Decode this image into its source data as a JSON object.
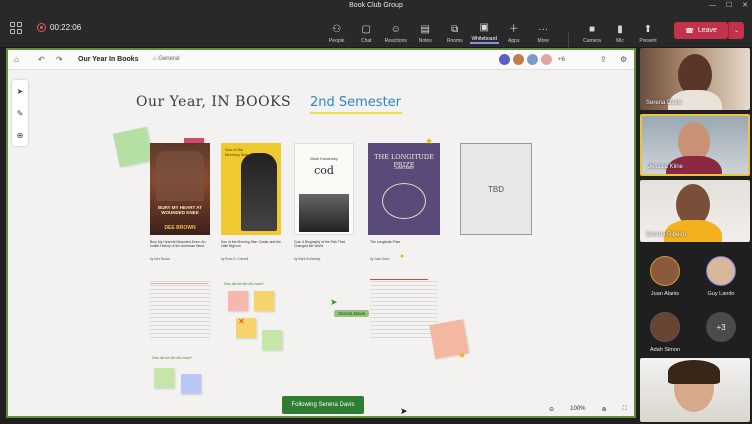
{
  "window": {
    "title": "Book Club Group"
  },
  "meeting": {
    "timer": "00:22:06",
    "toolbar": [
      {
        "label": "People",
        "icon": "people-icon"
      },
      {
        "label": "Chat",
        "icon": "chat-icon"
      },
      {
        "label": "Reactions",
        "icon": "reactions-icon"
      },
      {
        "label": "Notes",
        "icon": "notes-icon"
      },
      {
        "label": "Rooms",
        "icon": "rooms-icon"
      },
      {
        "label": "Whiteboard",
        "icon": "whiteboard-icon",
        "active": true
      },
      {
        "label": "Apps",
        "icon": "apps-icon"
      },
      {
        "label": "More",
        "icon": "more-icon"
      }
    ],
    "devices": [
      {
        "label": "Camera",
        "icon": "camera-icon"
      },
      {
        "label": "Mic",
        "icon": "mic-icon"
      },
      {
        "label": "Present",
        "icon": "present-icon"
      }
    ],
    "leave_label": "Leave"
  },
  "whiteboard": {
    "title": "Our Year In Books",
    "channel": "General",
    "extra_participants": "+6",
    "heading": "Our Year, IN BOOKS",
    "subheading": "2nd Semester",
    "tbd_label": "TBD",
    "following_label": "Following Serena Davis",
    "zoom": "100%",
    "cursor_tag": "Serena Davis",
    "books": [
      {
        "caption": "Bury My Heart at Wounded Knee: An Indian History of the American West",
        "author": "by Dee Brown",
        "cover_title": "BURY MY HEART AT WOUNDED KNEE",
        "cover_author": "DEE BROWN"
      },
      {
        "caption": "Son of the Morning Star: Custer and the Little Bighorn",
        "author": "by Evan S. Connell",
        "cover_title": "Son of the Morning Star",
        "cover_author": ""
      },
      {
        "caption": "Cod: A Biography of the Fish That Changed the World",
        "author": "by Mark Kurlansky",
        "cover_title": "cod",
        "cover_author": "Mark Kurlansky"
      },
      {
        "caption": "The Longitude Prize",
        "author": "by Joan Dash",
        "cover_title": "THE LONGITUDE PRIZE",
        "cover_author": "Joan Dash"
      }
    ],
    "green_prompts": [
      "How did we like this book?",
      "How did we like this book?"
    ]
  },
  "participants": [
    {
      "name": "Serena Davis"
    },
    {
      "name": "Jessica Kline"
    },
    {
      "name": "Serena Ribeiro"
    },
    {
      "name": "Juan Alanis"
    },
    {
      "name": "Guy Lando"
    },
    {
      "name": "Adah Simon"
    }
  ],
  "more_participants": "+3",
  "colors": {
    "accent": "#6264a7",
    "leave": "#c4314b",
    "whiteboard_border": "#5f8f3a",
    "following": "#2f7d32"
  }
}
